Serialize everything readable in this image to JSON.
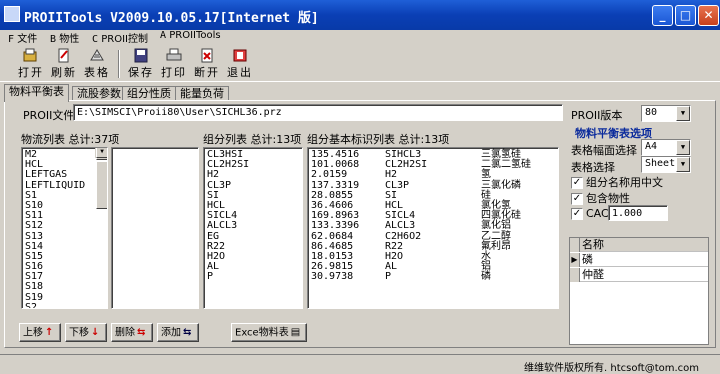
{
  "window": {
    "title": "PROIITools V2009.10.05.17[Internet 版]"
  },
  "menu": [
    {
      "key": "F",
      "label": "文件"
    },
    {
      "key": "B",
      "label": "物性"
    },
    {
      "key": "C",
      "label": "PROII控制"
    },
    {
      "key": "A",
      "label": "PROIITools"
    }
  ],
  "toolbar": {
    "open": "打开",
    "refresh": "刷新",
    "table": "表格",
    "save": "保存",
    "print": "打印",
    "disconnect": "断开",
    "exit": "退出"
  },
  "tabs": [
    "物料平衡表",
    "流股参数",
    "组分性质",
    "能量负荷"
  ],
  "proii_file": {
    "label": "PROII文件",
    "value": "E:\\SIMSCI\\Proii80\\User\\SICHL36.prz"
  },
  "proii_version": {
    "label": "PROII版本",
    "value": "80"
  },
  "streams": {
    "label": "物流列表 总计:37项",
    "items": [
      "M2",
      "HCL",
      "LEFTGAS",
      "LEFTLIQUID",
      "S1",
      "S10",
      "S11",
      "S12",
      "S13",
      "S14",
      "S15",
      "S16",
      "S17",
      "S18",
      "S19",
      "S2"
    ]
  },
  "components": {
    "label": "组分列表 总计:13项",
    "items": [
      "CL3HSI",
      "CL2H2SI",
      "H2",
      "CL3P",
      "SI",
      "HCL",
      "SICL4",
      "ALCL3",
      "EG",
      "R22",
      "H2O",
      "AL",
      "P"
    ]
  },
  "component_info": {
    "label": "组分基本标识列表 总计:13项",
    "rows": [
      {
        "mw": "135.4516",
        "id": "SIHCL3",
        "name": "三氯氢硅"
      },
      {
        "mw": "101.0068",
        "id": "CL2H2SI",
        "name": "二氯二氢硅"
      },
      {
        "mw": "2.0159",
        "id": "H2",
        "name": "氢"
      },
      {
        "mw": "137.3319",
        "id": "CL3P",
        "name": "三氯化磷"
      },
      {
        "mw": "28.0855",
        "id": "SI",
        "name": "硅"
      },
      {
        "mw": "36.4606",
        "id": "HCL",
        "name": "氯化氢"
      },
      {
        "mw": "169.8963",
        "id": "SICL4",
        "name": "四氯化硅"
      },
      {
        "mw": "133.3396",
        "id": "ALCL3",
        "name": "氯化铝"
      },
      {
        "mw": "62.0684",
        "id": "C2H6O2",
        "name": "乙二醇"
      },
      {
        "mw": "86.4685",
        "id": "R22",
        "name": "氟利昂"
      },
      {
        "mw": "18.0153",
        "id": "H2O",
        "name": "水"
      },
      {
        "mw": "26.9815",
        "id": "AL",
        "name": "铝"
      },
      {
        "mw": "30.9738",
        "id": "P",
        "name": "磷"
      }
    ]
  },
  "balance_options": {
    "title": "物料平衡表选项",
    "size_label": "表格幅面选择",
    "size_value": "A4",
    "sheet_label": "表格选择",
    "sheet_value": "Sheet1",
    "chinese_names": "组分名称用中文",
    "include_props": "包含物性",
    "cac_label": "CAC",
    "cac_value": "1.000"
  },
  "name_grid": {
    "header": "名称",
    "rows": [
      "磷",
      "仲醛"
    ]
  },
  "buttons": {
    "up": "上移",
    "down": "下移",
    "delete": "删除",
    "add": "添加",
    "excel": "Exce物料表"
  },
  "status": "维维软件版权所有. htcsoft@tom.com"
}
